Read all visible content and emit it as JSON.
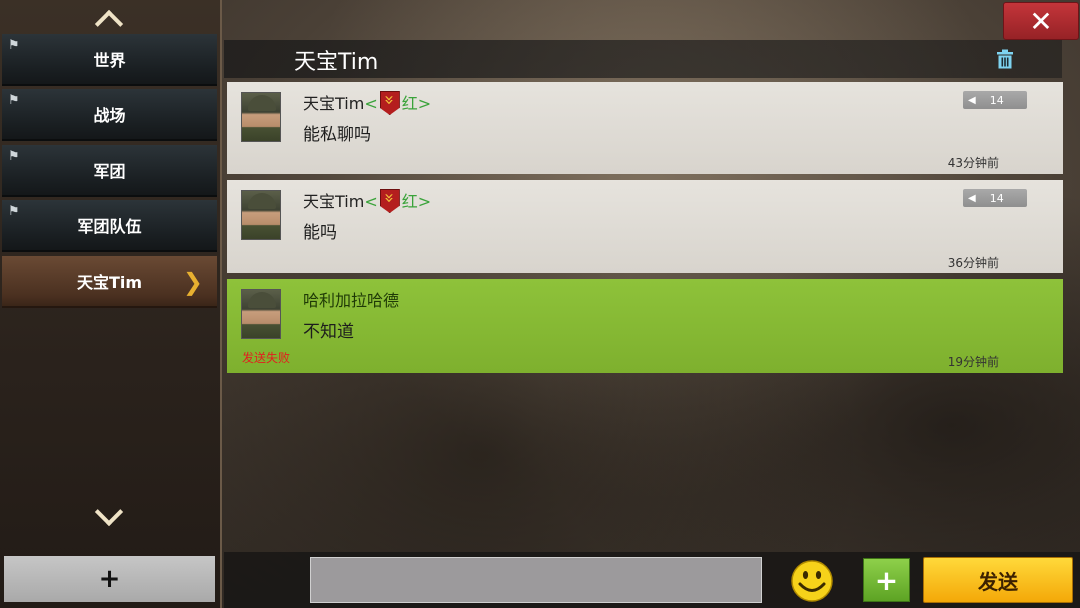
{
  "sidebar": {
    "channels": [
      {
        "label": "世界",
        "pin_icon": "pin-icon"
      },
      {
        "label": "战场",
        "pin_icon": "pin-icon"
      },
      {
        "label": "军团",
        "pin_icon": "pin-icon"
      },
      {
        "label": "军团队伍",
        "pin_icon": "pin-icon"
      },
      {
        "label": "天宝Tim",
        "active": true,
        "arrow_icon": "chevron-right-icon"
      }
    ],
    "add_label": "+"
  },
  "header": {
    "title": "天宝Tim",
    "close_label": "✕"
  },
  "messages": [
    {
      "sender": "天宝Tim",
      "tag_open": "<",
      "team": "红",
      "tag_close": ">",
      "text": "能私聊吗",
      "level": "14",
      "time": "43分钟前",
      "style": "grey"
    },
    {
      "sender": "天宝Tim",
      "tag_open": "<",
      "team": "红",
      "tag_close": ">",
      "text": "能吗",
      "level": "14",
      "time": "36分钟前",
      "style": "grey"
    },
    {
      "sender": "哈利加拉哈德",
      "text": "不知道",
      "time": "19分钟前",
      "status": "发送失败",
      "style": "green"
    }
  ],
  "composer": {
    "input_value": "",
    "plus_label": "+",
    "send_label": "发送"
  },
  "colors": {
    "accent_green": "#7eb02e",
    "close_red": "#c4353a",
    "send_yellow": "#f4a808",
    "fail_red": "#e21f1f"
  }
}
